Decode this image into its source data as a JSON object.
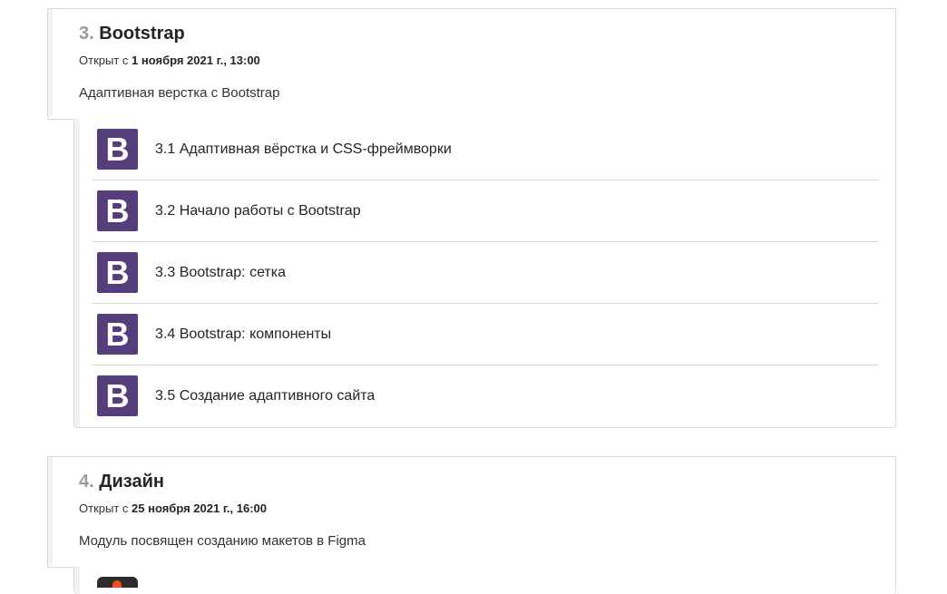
{
  "sections": [
    {
      "number": "3.",
      "title": "Bootstrap",
      "avail_prefix": "Открыт с ",
      "avail_date": "1 ноября 2021 г., 13:00",
      "summary": "Адаптивная верстка с Bootstrap",
      "activities": [
        {
          "icon": "bootstrap-icon",
          "icon_letter": "B",
          "label": "3.1 Адаптивная вёрстка и CSS-фреймворки"
        },
        {
          "icon": "bootstrap-icon",
          "icon_letter": "B",
          "label": "3.2 Начало работы с Bootstrap"
        },
        {
          "icon": "bootstrap-icon",
          "icon_letter": "B",
          "label": "3.3 Bootstrap: сетка"
        },
        {
          "icon": "bootstrap-icon",
          "icon_letter": "B",
          "label": "3.4 Bootstrap: компоненты"
        },
        {
          "icon": "bootstrap-icon",
          "icon_letter": "B",
          "label": "3.5 Создание адаптивного сайта"
        }
      ]
    },
    {
      "number": "4.",
      "title": "Дизайн",
      "avail_prefix": "Открыт с ",
      "avail_date": "25 ноября 2021 г., 16:00",
      "summary": "Модуль посвящен созданию макетов в Figma",
      "activities": [
        {
          "icon": "figma-icon"
        }
      ]
    }
  ],
  "colors": {
    "bootstrap_purple": "#563d7c",
    "number_gray": "#999999",
    "border": "#d9d9d9"
  }
}
